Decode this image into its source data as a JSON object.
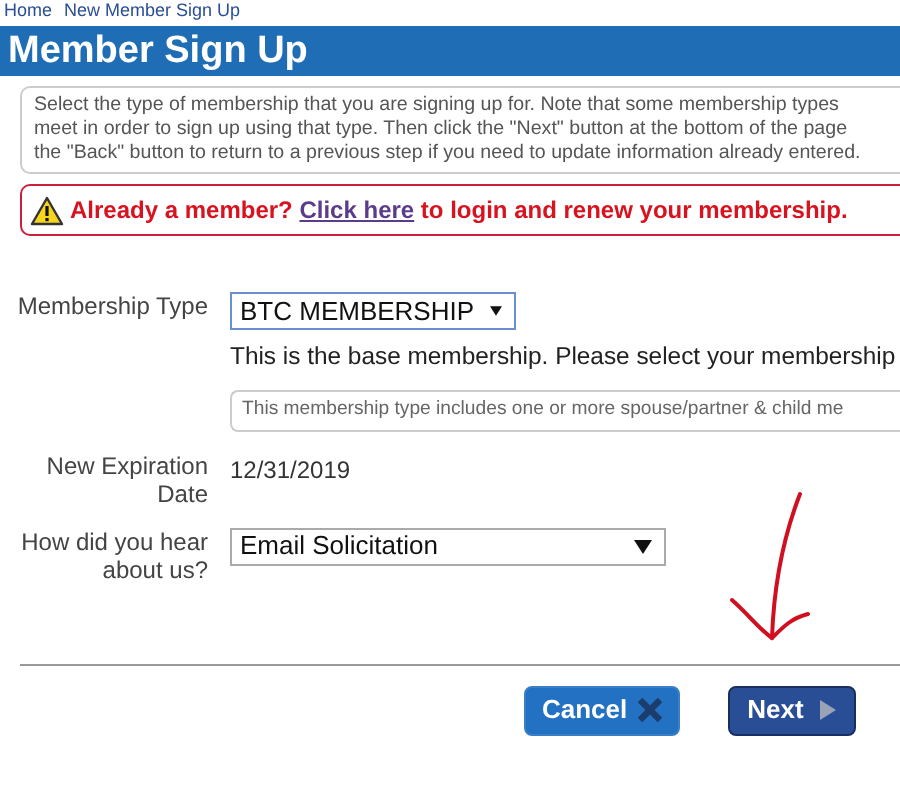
{
  "breadcrumb": [
    "Home",
    "New Member Sign Up"
  ],
  "title": "Member Sign Up",
  "instructions": [
    "Select the type of membership that you are signing up for. Note that some membership types",
    "meet in order to sign up using that type. Then click the \"Next\" button at the bottom of the page",
    "the \"Back\" button to return to a previous step if you need to update information already entered."
  ],
  "alert": {
    "before": "Already a member?",
    "link": "Click here",
    "after": "to login and renew your membership."
  },
  "fields": [
    {
      "kind": "select",
      "label": "Membership Type",
      "value": "BTC MEMBERSHIP",
      "focused": true,
      "description": "This is the base membership. Please select your membership",
      "note": "This membership type includes one or more spouse/partner & child me"
    },
    {
      "kind": "text",
      "label": "New Expiration Date",
      "value": "12/31/2019"
    },
    {
      "kind": "select",
      "label": "How did you hear about us?",
      "value": "Email Solicitation",
      "focused": false
    }
  ],
  "buttons": [
    {
      "kind": "cancel",
      "label": "Cancel"
    },
    {
      "kind": "next",
      "label": "Next"
    }
  ]
}
